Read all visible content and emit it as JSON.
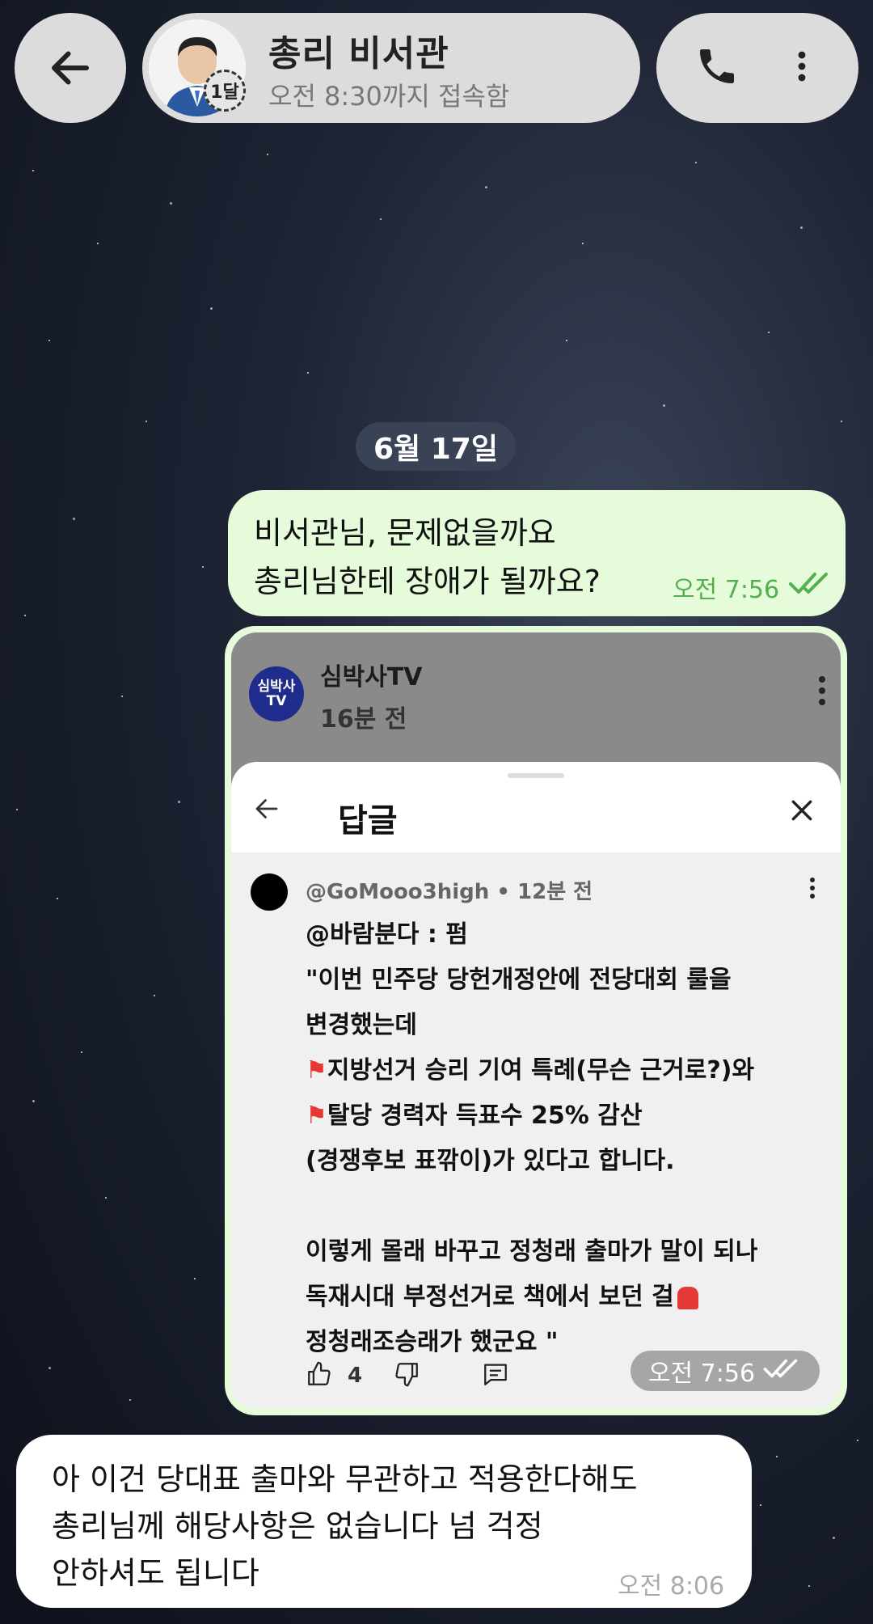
{
  "header": {
    "contact_name": "총리 비서관",
    "status": "오전 8:30까지 접속함",
    "story_badge": "1달"
  },
  "date_chip": "6월 17일",
  "messages": {
    "out1": {
      "line1": "비서관님, 문제없을까요",
      "line2": "총리님한테 장애가 될까요?",
      "time": "오전 7:56"
    },
    "out2": {
      "time": "오전 7:56",
      "screenshot": {
        "channel_logo": "심박사 TV",
        "channel": "심박사TV",
        "posted": "16분 전",
        "sheet_title": "답글",
        "comment_author": "@GoMooo3high • 12분 전",
        "lines": [
          "@바람분다 : 펌",
          "\"이번 민주당 당헌개정안에 전당대회 룰을",
          "변경했는데",
          "지방선거 승리 기여 특례(무슨 근거로?)와",
          "탈당 경력자 득표수 25% 감산",
          "(경쟁후보 표깎이)가 있다고 합니다.",
          "이렇게 몰래 바꾸고 정청래 출마가 말이 되나",
          "독재시대 부정선거로 책에서 보던 걸",
          "정청래조승래가 했군요 \""
        ],
        "like_count": "4"
      }
    },
    "in1": {
      "line1": "아 이건 당대표 출마와 무관하고 적용한다해도",
      "line2": "총리님께 해당사항은 없습니다 넘 걱정",
      "line3": "안하셔도 됩니다",
      "time": "오전 8:06"
    }
  },
  "colors": {
    "outgoing_bubble": "#e5fbd9",
    "incoming_bubble": "#ffffff",
    "read_check": "#54b04e",
    "header_pill": "#dcdcdc",
    "date_chip": "#3a4256"
  }
}
